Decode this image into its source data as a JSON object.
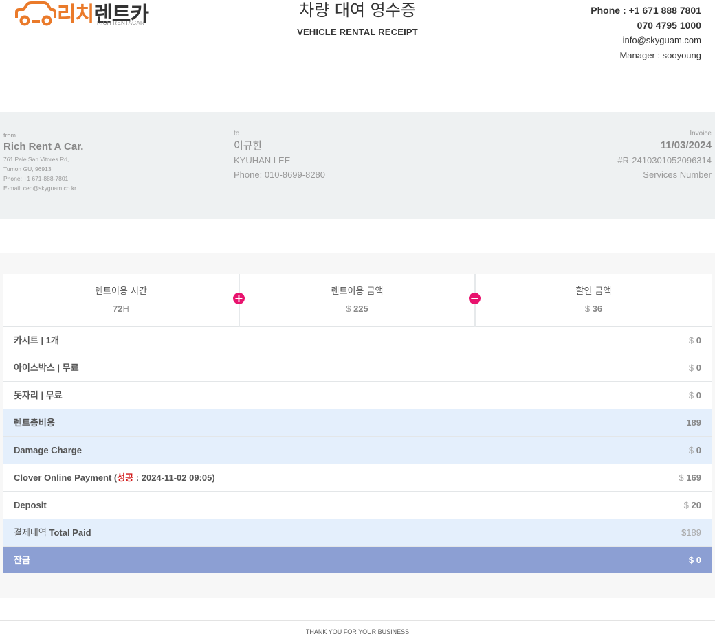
{
  "brand": {
    "name_ko_orange": "리치",
    "name_ko_dark": "렌트카",
    "name_en": "RICH RENTACAR",
    "accent_color": "#ea7a2a"
  },
  "title": {
    "ko": "차량 대여 영수증",
    "en": "VEHICLE RENTAL RECEIPT"
  },
  "contact": {
    "phone": "Phone : +1 671 888 7801",
    "phone2": "070 4795 1000",
    "email": "info@skyguam.com",
    "manager": "Manager : sooyoung"
  },
  "from": {
    "label": "from",
    "name": "Rich Rent A Car.",
    "address1": "761 Pale San Vitores Rd,",
    "address2": "Tumon GU, 96913",
    "phone": "Phone: +1 671-888-7801",
    "email": "E-mail: ceo@skyguam.co.kr"
  },
  "to": {
    "label": "to",
    "name_ko": "이규한",
    "name_en": "KYUHAN LEE",
    "phone": "Phone: 010-8699-8280"
  },
  "invoice": {
    "label": "Invoice",
    "date": "11/03/2024",
    "number": "#R-2410301052096314",
    "number_label": "Services Number"
  },
  "summary": {
    "rental_hours": {
      "label": "렌트이용 시간",
      "value": "72",
      "unit": "H"
    },
    "rental_amount": {
      "label": "렌트이용 금액",
      "currency": "$",
      "value": "225"
    },
    "discount": {
      "label": "할인 금액",
      "currency": "$",
      "value": "36"
    },
    "plus_icon": "plus-circle-icon",
    "minus_icon": "minus-circle-icon",
    "operator_color": "#e8136e"
  },
  "line_items": [
    {
      "label": "카시트 | 1개",
      "currency": "$",
      "amount": "0"
    },
    {
      "label": "아이스박스 | 무료",
      "currency": "$",
      "amount": "0"
    },
    {
      "label": "돗자리 | 무료",
      "currency": "$",
      "amount": "0"
    }
  ],
  "rental_total": {
    "label": "렌트총비용",
    "amount": "189"
  },
  "damage": {
    "label": "Damage Charge",
    "currency": "$",
    "amount": "0"
  },
  "payment": {
    "label_prefix": "Clover Online Payment (",
    "status": "성공",
    "label_suffix": " : 2024-11-02 09:05)",
    "currency": "$",
    "amount": "169"
  },
  "deposit": {
    "label": "Deposit",
    "currency": "$",
    "amount": "20"
  },
  "total_paid": {
    "label_ko": "결제내역",
    "label_en": "Total Paid",
    "amount": "$189"
  },
  "balance": {
    "label": "잔금",
    "amount": "$ 0"
  },
  "colors": {
    "highlight_row": "#e4effc",
    "balance_row": "#8c9fd3",
    "status_red": "#d21a1a"
  },
  "footer": {
    "text": "THANK YOU FOR YOUR BUSINESS"
  }
}
